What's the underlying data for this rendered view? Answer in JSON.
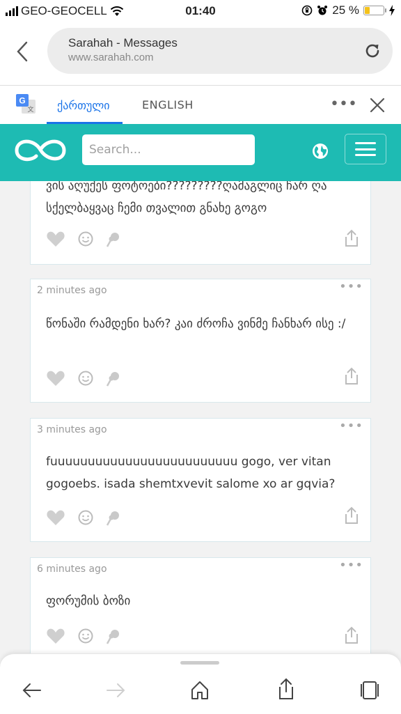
{
  "status": {
    "carrier": "GEO-GEOCELL",
    "time": "01:40",
    "battery": "25 %"
  },
  "browser": {
    "page_title": "Sarahah - Messages",
    "url": "www.sarahah.com"
  },
  "translate": {
    "tab_georgian": "ქართული",
    "tab_english": "ENGLISH"
  },
  "site": {
    "search_placeholder": "Search..."
  },
  "messages": [
    {
      "time": "",
      "text": "ვის აღუქეს ფოტოები?????????ღამაგლიც ჩარ ღა სქელბაყვაც ჩემი თვალით გნახე გოგო"
    },
    {
      "time": "2 minutes ago",
      "text": "წონაში რამდენი ხარ? კაი ძროჩა ვინმე ჩანხარ ისე :/"
    },
    {
      "time": "3 minutes ago",
      "text": "fuuuuuuuuuuuuuuuuuuuuuuuuu gogo, ver vitan gogoebs. isada shemtxvevit salome xo ar gqvia?"
    },
    {
      "time": "6 minutes ago",
      "text": "ფორუმის ბოზი"
    }
  ],
  "colors": {
    "brand": "#1ebbb3",
    "link_blue": "#1a73e8"
  }
}
